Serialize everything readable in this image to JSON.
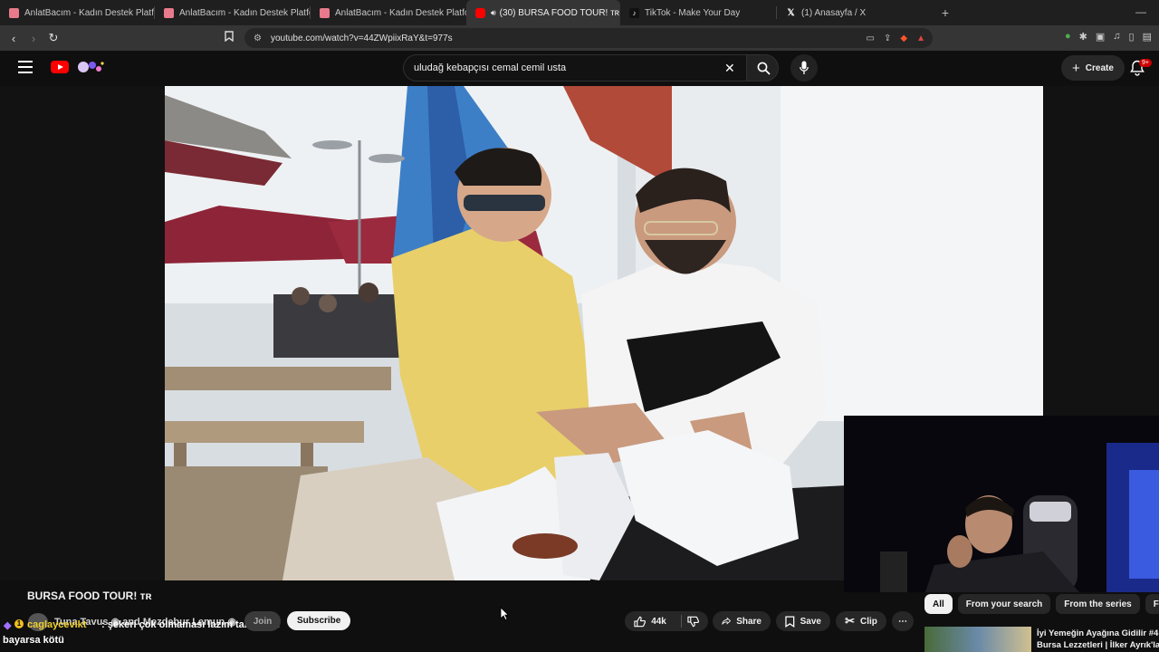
{
  "browser": {
    "tabs": [
      {
        "label": "AnlatBacım - Kadın Destek Platformu",
        "active": false,
        "favicon_color": "#e87a8c"
      },
      {
        "label": "AnlatBacım - Kadın Destek Platformu",
        "active": false,
        "favicon_color": "#e87a8c"
      },
      {
        "label": "AnlatBacım - Kadın Destek Platformu",
        "active": false,
        "favicon_color": "#e87a8c"
      },
      {
        "label": "(30) BURSA FOOD TOUR! ᴛʀ -",
        "active": true,
        "favicon_color": "#ff0000"
      },
      {
        "label": "TikTok - Make Your Day",
        "active": false,
        "favicon_color": "#111111"
      },
      {
        "label": "(1) Anasayfa / X",
        "active": false,
        "favicon_color": "#111111"
      }
    ],
    "url": "youtube.com/watch?v=44ZWpiixRaY&t=977s"
  },
  "youtube": {
    "search_query": "uludağ kebapçısı cemal cemil usta",
    "create_label": "Create",
    "notification_badge": "9+",
    "accent_color": "#ff0000"
  },
  "video": {
    "title": "BURSA FOOD TOUR! ᴛʀ",
    "channel_overlay": "Tuna Tavus ◉ and Mezdebur Lemun ◉",
    "join_label": "Join",
    "subscribe_label": "Subscribe",
    "like_count": "44k",
    "share_label": "Share",
    "save_label": "Save",
    "clip_label": "Clip"
  },
  "chat_overlay": {
    "username": "caglaycevikt",
    "message": ": şekeri çok olmaması lazım tahinlinin",
    "continuation": "bayarsa kötü"
  },
  "sidebar": {
    "chips": [
      "All",
      "From your search",
      "From the series",
      "Fr"
    ],
    "recommended_title_line1": "İyi Yemeğin Ayağına Gidilir #4 |",
    "recommended_title_line2": "Bursa Lezzetleri | İlker Ayrık'la"
  }
}
